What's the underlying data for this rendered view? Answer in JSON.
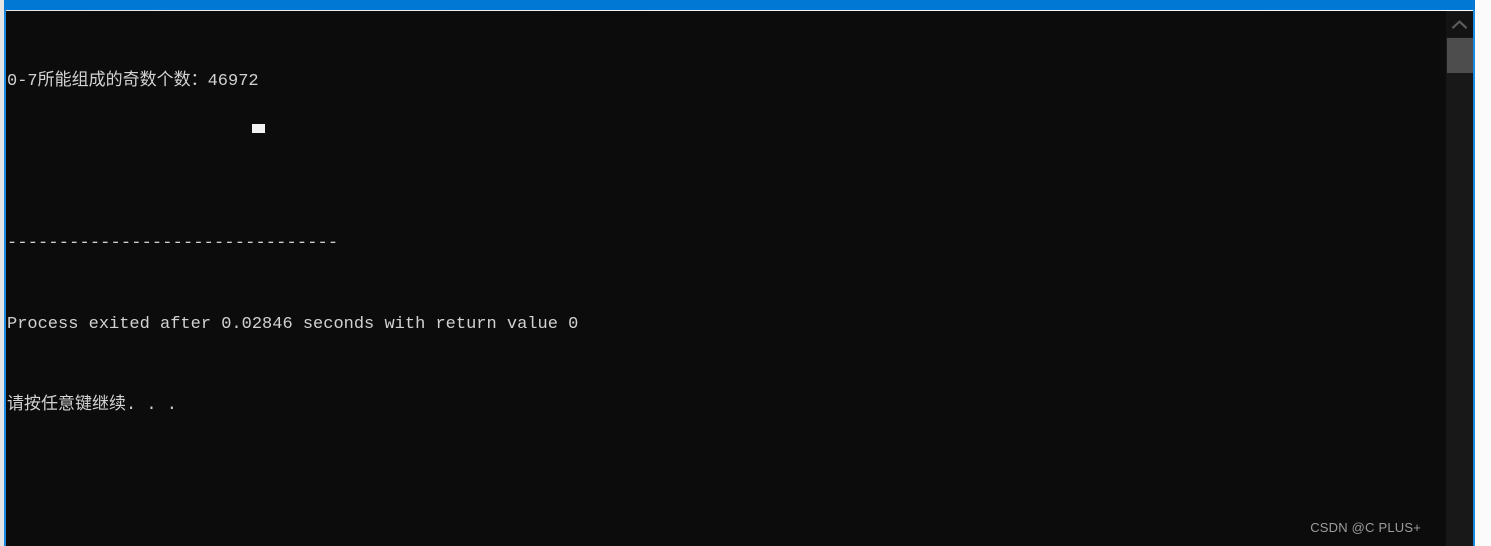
{
  "window": {
    "title_bar_color": "#0178d4",
    "border_color": "#1a8ae0",
    "console_background": "#0c0c0c",
    "console_foreground": "#d2d2d2"
  },
  "console": {
    "lines": [
      "0-7所能组成的奇数个数：46972",
      "",
      "--------------------------------",
      "Process exited after 0.02846 seconds with return value 0",
      "请按任意键继续. . ."
    ],
    "result_label": "0-7所能组成的奇数个数：",
    "result_value": "46972",
    "separator": "--------------------------------",
    "exit_message": "Process exited after 0.02846 seconds with return value 0",
    "exit_seconds": "0.02846",
    "exit_return_value": "0",
    "press_any_key": "请按任意键继续. . .",
    "cursor": "block-cursor"
  },
  "scrollbar": {
    "up_arrow": "chevron-up-icon",
    "thumb_color": "#4d4d4d",
    "track_color": "#181818"
  },
  "watermark": {
    "text": "CSDN @C PLUS+"
  }
}
